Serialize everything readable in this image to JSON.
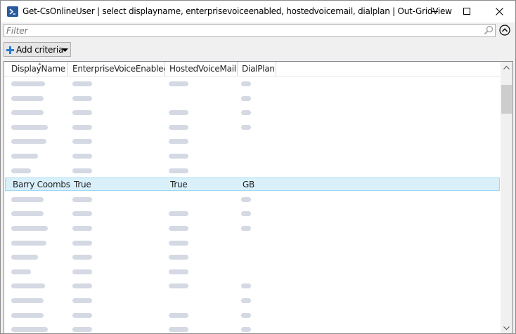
{
  "window": {
    "title": "Get-CsOnlineUser | select displayname, enterprisevoiceenabled, hostedvoicemail, dialplan | Out-GridView"
  },
  "filter": {
    "placeholder": "Filter",
    "value": ""
  },
  "toolbar": {
    "add_criteria_label": "Add criteria"
  },
  "grid": {
    "columns": [
      "DisplayName",
      "EnterpriseVoiceEnabled",
      "HostedVoiceMail",
      "DialPlan"
    ],
    "sort_column": "DisplayName",
    "rows": [
      {
        "display_name": "",
        "enterprise_voice": "",
        "hosted_voicemail": "",
        "dial_plan": "",
        "obscured": true
      },
      {
        "display_name": "",
        "enterprise_voice": "",
        "hosted_voicemail": "",
        "dial_plan": "",
        "obscured": true
      },
      {
        "display_name": "",
        "enterprise_voice": "",
        "hosted_voicemail": "",
        "dial_plan": "",
        "obscured": true
      },
      {
        "display_name": "",
        "enterprise_voice": "",
        "hosted_voicemail": "",
        "dial_plan": "",
        "obscured": true
      },
      {
        "display_name": "",
        "enterprise_voice": "",
        "hosted_voicemail": "",
        "dial_plan": "",
        "obscured": true
      },
      {
        "display_name": "",
        "enterprise_voice": "",
        "hosted_voicemail": "",
        "dial_plan": "",
        "obscured": true
      },
      {
        "display_name": "",
        "enterprise_voice": "",
        "hosted_voicemail": "",
        "dial_plan": "",
        "obscured": true
      },
      {
        "display_name": "Barry Coombs",
        "enterprise_voice": "True",
        "hosted_voicemail": "True",
        "dial_plan": "GB",
        "obscured": false,
        "selected": true
      },
      {
        "display_name": "",
        "enterprise_voice": "",
        "hosted_voicemail": "",
        "dial_plan": "",
        "obscured": true
      },
      {
        "display_name": "",
        "enterprise_voice": "",
        "hosted_voicemail": "",
        "dial_plan": "",
        "obscured": true
      },
      {
        "display_name": "",
        "enterprise_voice": "",
        "hosted_voicemail": "",
        "dial_plan": "",
        "obscured": true
      },
      {
        "display_name": "",
        "enterprise_voice": "",
        "hosted_voicemail": "",
        "dial_plan": "",
        "obscured": true
      },
      {
        "display_name": "",
        "enterprise_voice": "",
        "hosted_voicemail": "",
        "dial_plan": "",
        "obscured": true
      },
      {
        "display_name": "",
        "enterprise_voice": "",
        "hosted_voicemail": "",
        "dial_plan": "",
        "obscured": true
      },
      {
        "display_name": "",
        "enterprise_voice": "",
        "hosted_voicemail": "",
        "dial_plan": "",
        "obscured": true
      },
      {
        "display_name": "",
        "enterprise_voice": "",
        "hosted_voicemail": "",
        "dial_plan": "",
        "obscured": true
      },
      {
        "display_name": "",
        "enterprise_voice": "",
        "hosted_voicemail": "",
        "dial_plan": "",
        "obscured": true
      },
      {
        "display_name": "",
        "enterprise_voice": "",
        "hosted_voicemail": "",
        "dial_plan": "",
        "obscured": true
      }
    ]
  },
  "colors": {
    "selection_fill": "#d9f0fb",
    "selection_border": "#9fd8f3",
    "icon_blue": "#2a5aa0",
    "plus_blue": "#2b79d0",
    "blur": "#d4d9e3"
  },
  "icons": {
    "app": "powershell-icon",
    "filter": "search-icon",
    "collapse": "chevron-up-circle-icon",
    "add": "plus-icon",
    "dropdown": "triangle-down-icon"
  }
}
